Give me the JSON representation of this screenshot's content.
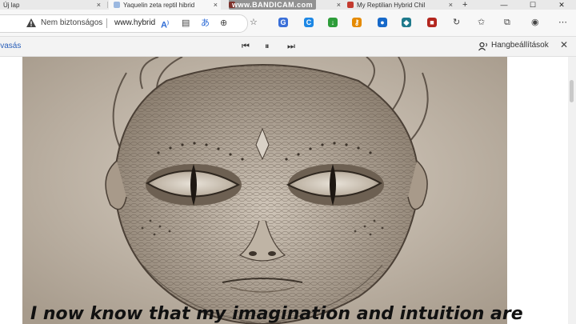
{
  "browser": {
    "tabs": [
      {
        "title": "Új lap",
        "favicon": "edge-newtab-icon"
      },
      {
        "title": "Yaquelin zeta reptil hibrid",
        "favicon": "page-icon"
      },
      {
        "title": "BANDICAM",
        "favicon": "red-site-icon"
      },
      {
        "title": "My Reptilian Hybrid Chil",
        "favicon": "red-site-icon"
      }
    ],
    "new_tab": "+",
    "tab_close": "×",
    "address": {
      "security_label": "Nem biztonságos",
      "url": "www.hybrid"
    },
    "read_aloud": {
      "left_label": "lvasás",
      "voice_settings": "Hangbeállítások",
      "close": "✕"
    }
  },
  "recorder_watermark": "www.BANDICAM.com",
  "article": {
    "caption": "I now know that my imagination and intuition are"
  },
  "colors": {
    "tabbar": "#e9e9e9",
    "toolbar": "#f7f7f7",
    "accent": "#2d6bd6"
  }
}
